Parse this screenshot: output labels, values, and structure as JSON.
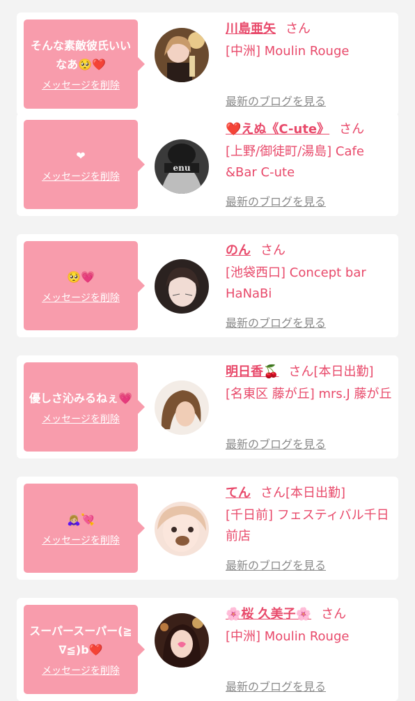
{
  "cards": [
    {
      "message": "そんな素敵彼氏いいなあ🥺❤️",
      "delete_label": "メッセージを削除",
      "name": "川島亜矢",
      "honorific": "さん",
      "status": "",
      "shop": "[中洲] Moulin Rouge",
      "blog_label": "最新のブログを見る"
    },
    {
      "message": "❤",
      "delete_label": "メッセージを削除",
      "name": "❤️えぬ《C-ute》",
      "honorific": "さん",
      "status": "",
      "shop": "[上野/御徒町/湯島] Cafe &Bar C-ute",
      "blog_label": "最新のブログを見る"
    },
    {
      "message": "🥺💗",
      "delete_label": "メッセージを削除",
      "name": "のん",
      "honorific": "さん",
      "status": "",
      "shop": "[池袋西口] Concept bar HaNaBi",
      "blog_label": "最新のブログを見る"
    },
    {
      "message": "優しさ沁みるねぇ💗",
      "delete_label": "メッセージを削除",
      "name": "明日香🍒",
      "honorific": "さん",
      "status": "[本日出勤]",
      "shop": "[名東区 藤が丘] mrs.J 藤が丘",
      "blog_label": "最新のブログを見る"
    },
    {
      "message": "🙇🏼‍♀️💘",
      "delete_label": "メッセージを削除",
      "name": "てん",
      "honorific": "さん",
      "status": "[本日出勤]",
      "shop": "[千日前] フェスティバル千日前店",
      "blog_label": "最新のブログを見る"
    },
    {
      "message": "スーパースーパー(≧∇≦)b❤️",
      "delete_label": "メッセージを削除",
      "name": "🌸桜 久美子🌸",
      "honorific": "さん",
      "status": "",
      "shop": "[中洲] Moulin Rouge",
      "blog_label": "最新のブログを見る"
    }
  ]
}
